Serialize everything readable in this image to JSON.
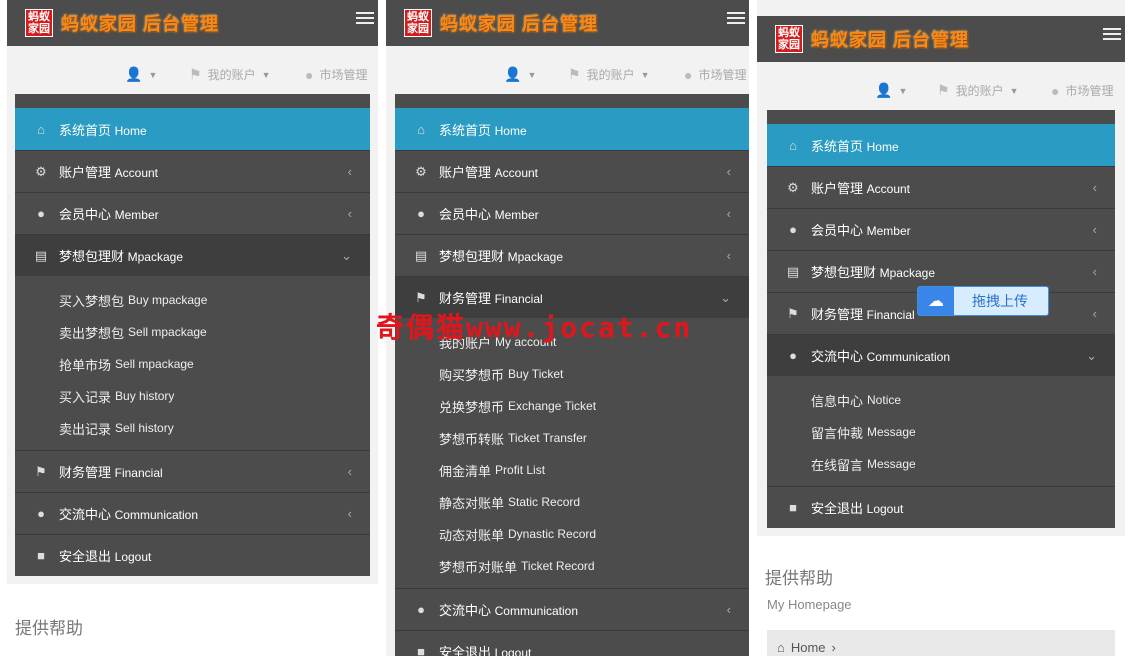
{
  "brand": {
    "badge_line1": "蚂蚁",
    "badge_line2": "家园",
    "title": "蚂蚁家园 后台管理"
  },
  "toolbar": {
    "account": "我的账户",
    "market": "市场管理"
  },
  "icons": {
    "home": "home-icon",
    "account": "gear-icon",
    "member": "user-icon",
    "mpackage": "cart-icon",
    "financial": "tags-icon",
    "communication": "comments-icon",
    "logout": "lock-icon"
  },
  "nav": {
    "home": {
      "zh": "系统首页",
      "en": "Home"
    },
    "account": {
      "zh": "账户管理",
      "en": "Account"
    },
    "member": {
      "zh": "会员中心",
      "en": "Member"
    },
    "mpackage": {
      "zh": "梦想包理财",
      "en": "Mpackage"
    },
    "financial": {
      "zh": "财务管理",
      "en": "Financial"
    },
    "communication": {
      "zh": "交流中心",
      "en": "Communication"
    },
    "logout": {
      "zh": "安全退出",
      "en": "Logout"
    }
  },
  "mpackage_sub": [
    {
      "zh": "买入梦想包",
      "en": "Buy mpackage"
    },
    {
      "zh": "卖出梦想包",
      "en": "Sell mpackage"
    },
    {
      "zh": "抢单市场",
      "en": "Sell mpackage"
    },
    {
      "zh": "买入记录",
      "en": "Buy history"
    },
    {
      "zh": "卖出记录",
      "en": "Sell history"
    }
  ],
  "financial_sub": [
    {
      "zh": "我的账户",
      "en": "My account"
    },
    {
      "zh": "购买梦想币",
      "en": "Buy Ticket"
    },
    {
      "zh": "兑换梦想币",
      "en": "Exchange Ticket"
    },
    {
      "zh": "梦想币转账",
      "en": "Ticket Transfer"
    },
    {
      "zh": "佣金清单",
      "en": "Profit List"
    },
    {
      "zh": "静态对账单",
      "en": "Static Record"
    },
    {
      "zh": "动态对账单",
      "en": "Dynastic Record"
    },
    {
      "zh": "梦想币对账单",
      "en": "Ticket Record"
    }
  ],
  "communication_sub": [
    {
      "zh": "信息中心",
      "en": "Notice"
    },
    {
      "zh": "留言仲裁",
      "en": "Message"
    },
    {
      "zh": "在线留言",
      "en": "Message"
    }
  ],
  "help": {
    "title": "提供帮助",
    "subtitle": "My Homepage",
    "breadcrumb": "Home"
  },
  "watermark": "奇偶猫www.jocat.cn",
  "upload_badge": "拖拽上传"
}
